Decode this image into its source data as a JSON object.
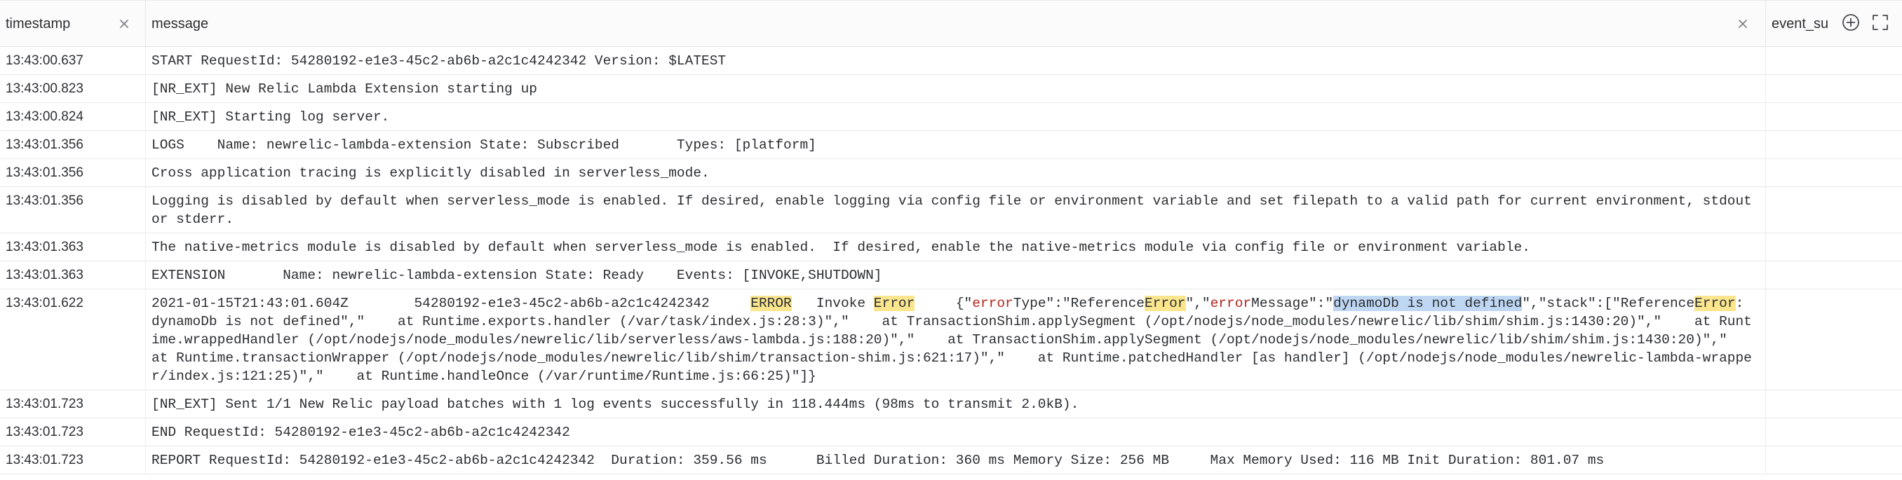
{
  "columns": {
    "timestamp": "timestamp",
    "message": "message",
    "event": "event_su"
  },
  "icons": {
    "close": "close-icon",
    "add_column": "plus-circle-icon",
    "expand": "expand-icon"
  },
  "colors": {
    "highlight_yellow": "#fbe68d",
    "highlight_blue": "#bfd7f3",
    "error_red": "#b3261e"
  },
  "rows": [
    {
      "timestamp": "13:43:00.637",
      "message": "START RequestId: 54280192-e1e3-45c2-ab6b-a2c1c4242342 Version: $LATEST"
    },
    {
      "timestamp": "13:43:00.823",
      "message": "[NR_EXT] New Relic Lambda Extension starting up"
    },
    {
      "timestamp": "13:43:00.824",
      "message": "[NR_EXT] Starting log server."
    },
    {
      "timestamp": "13:43:01.356",
      "message": "LOGS    Name: newrelic-lambda-extension State: Subscribed       Types: [platform]"
    },
    {
      "timestamp": "13:43:01.356",
      "message": "Cross application tracing is explicitly disabled in serverless_mode."
    },
    {
      "timestamp": "13:43:01.356",
      "message": "Logging is disabled by default when serverless_mode is enabled. If desired, enable logging via config file or environment variable and set filepath to a valid path for current environment, stdout or stderr."
    },
    {
      "timestamp": "13:43:01.363",
      "message": "The native-metrics module is disabled by default when serverless_mode is enabled.  If desired, enable the native-metrics module via config file or environment variable."
    },
    {
      "timestamp": "13:43:01.363",
      "message": "EXTENSION       Name: newrelic-lambda-extension State: Ready    Events: [INVOKE,SHUTDOWN]"
    },
    {
      "timestamp": "13:43:01.622",
      "segments": [
        {
          "text": "2021-01-15T21:43:01.604Z        54280192-e1e3-45c2-ab6b-a2c1c4242342     ",
          "style": ""
        },
        {
          "text": "ERROR",
          "style": "yellow"
        },
        {
          "text": "   Invoke ",
          "style": ""
        },
        {
          "text": "Error",
          "style": "yellow"
        },
        {
          "text": "     {\"",
          "style": ""
        },
        {
          "text": "error",
          "style": "red"
        },
        {
          "text": "Type\":\"Reference",
          "style": ""
        },
        {
          "text": "Error",
          "style": "yellow"
        },
        {
          "text": "\",\"",
          "style": ""
        },
        {
          "text": "error",
          "style": "red"
        },
        {
          "text": "Message\":\"",
          "style": ""
        },
        {
          "text": "dynamoDb is not defined",
          "style": "blue"
        },
        {
          "text": "\",\"stack\":[\"Reference",
          "style": ""
        },
        {
          "text": "Error",
          "style": "yellow"
        },
        {
          "text": ": dynamoDb is not defined\",\"    at Runtime.exports.handler (/var/task/index.js:28:3)\",\"    at TransactionShim.applySegment (/opt/nodejs/node_modules/newrelic/lib/shim/shim.js:1430:20)\",\"    at Runtime.wrappedHandler (/opt/nodejs/node_modules/newrelic/lib/serverless/aws-lambda.js:188:20)\",\"    at TransactionShim.applySegment (/opt/nodejs/node_modules/newrelic/lib/shim/shim.js:1430:20)\",\"    at Runtime.transactionWrapper (/opt/nodejs/node_modules/newrelic/lib/shim/transaction-shim.js:621:17)\",\"    at Runtime.patchedHandler [as handler] (/opt/nodejs/node_modules/newrelic-lambda-wrapper/index.js:121:25)\",\"    at Runtime.handleOnce (/var/runtime/Runtime.js:66:25)\"]}",
          "style": ""
        }
      ]
    },
    {
      "timestamp": "13:43:01.723",
      "message": "[NR_EXT] Sent 1/1 New Relic payload batches with 1 log events successfully in 118.444ms (98ms to transmit 2.0kB)."
    },
    {
      "timestamp": "13:43:01.723",
      "message": "END RequestId: 54280192-e1e3-45c2-ab6b-a2c1c4242342"
    },
    {
      "timestamp": "13:43:01.723",
      "message": "REPORT RequestId: 54280192-e1e3-45c2-ab6b-a2c1c4242342  Duration: 359.56 ms      Billed Duration: 360 ms Memory Size: 256 MB     Max Memory Used: 116 MB Init Duration: 801.07 ms"
    }
  ]
}
